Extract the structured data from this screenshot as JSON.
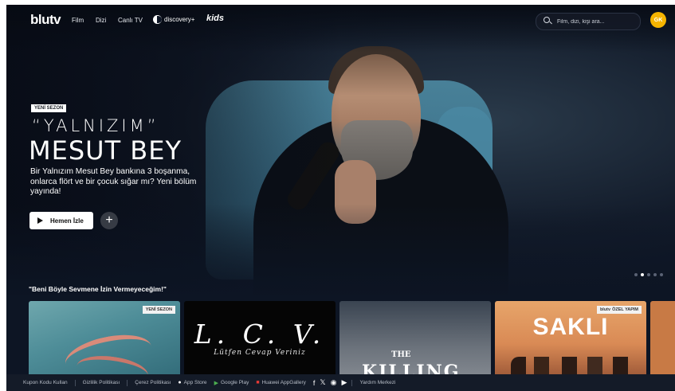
{
  "brand": {
    "logo": "blutv"
  },
  "nav": {
    "links": [
      "Film",
      "Dizi",
      "Canlı TV"
    ],
    "discovery": "discovery+",
    "kids": "kids"
  },
  "search": {
    "placeholder": "Film, dizi, kişi ara..."
  },
  "user": {
    "initials": "GK",
    "avatar_color": "#f5b400"
  },
  "hero": {
    "badge": "YENİ SEZON",
    "title_line1": "“YALNIZIM”",
    "title_line2": "MESUT BEY",
    "description": "Bir Yalnızım Mesut Bey bankına 3 boşanma, onlarca flört ve bir çocuk sığar mı? Yeni bölüm yayında!",
    "play_label": "Hemen İzle",
    "add_label": "+",
    "carousel_dots": 5,
    "active_dot": 1
  },
  "row": {
    "title": "\"Beni Böyle Sevmene İzin Vermeyeceğim!\"",
    "cards": [
      {
        "badge": "YENİ SEZON"
      },
      {
        "title": "L. C. V.",
        "subtitle": "Lütfen Cevap Veriniz"
      },
      {
        "title_small": "THE",
        "title_big": "KILLING"
      },
      {
        "badge_logo": "blutv",
        "badge": "ÖZEL YAPIM",
        "title": "SAKLI"
      },
      {}
    ]
  },
  "footer": {
    "links": [
      "Kupon Kodu Kullan",
      "Gizlilik Politikası",
      "Çerez Politikası"
    ],
    "stores": [
      "App Store",
      "Google Play",
      "Huawei AppGallery"
    ],
    "social": [
      "facebook-icon",
      "x-icon",
      "instagram-icon",
      "youtube-icon"
    ],
    "help": "Yardım Merkezi"
  }
}
